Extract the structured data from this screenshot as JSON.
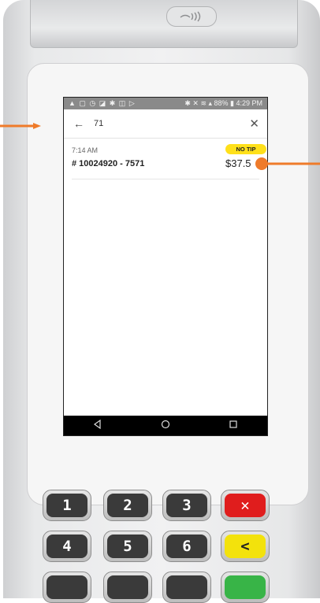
{
  "status_bar": {
    "left_icons": "▲ ▢ ◷ ◪ ✱ ◫ ▷",
    "right_text": "✱ ✕ ≋ ▴ 88% ▮ 4:29 PM"
  },
  "search": {
    "query": "71"
  },
  "results": [
    {
      "time": "7:14 AM",
      "badge": "NO TIP",
      "order": "# 10024920 - 7571",
      "amount": "$37.5"
    }
  ],
  "keypad": {
    "keys": [
      "1",
      "2",
      "3",
      "✕",
      "4",
      "5",
      "6",
      "<"
    ]
  },
  "colors": {
    "annotation_orange": "#ef7b2a",
    "badge_yellow": "#ffe01a",
    "cancel_red": "#e01d1d",
    "clear_yellow": "#f3e20c",
    "enter_green": "#38b447"
  }
}
